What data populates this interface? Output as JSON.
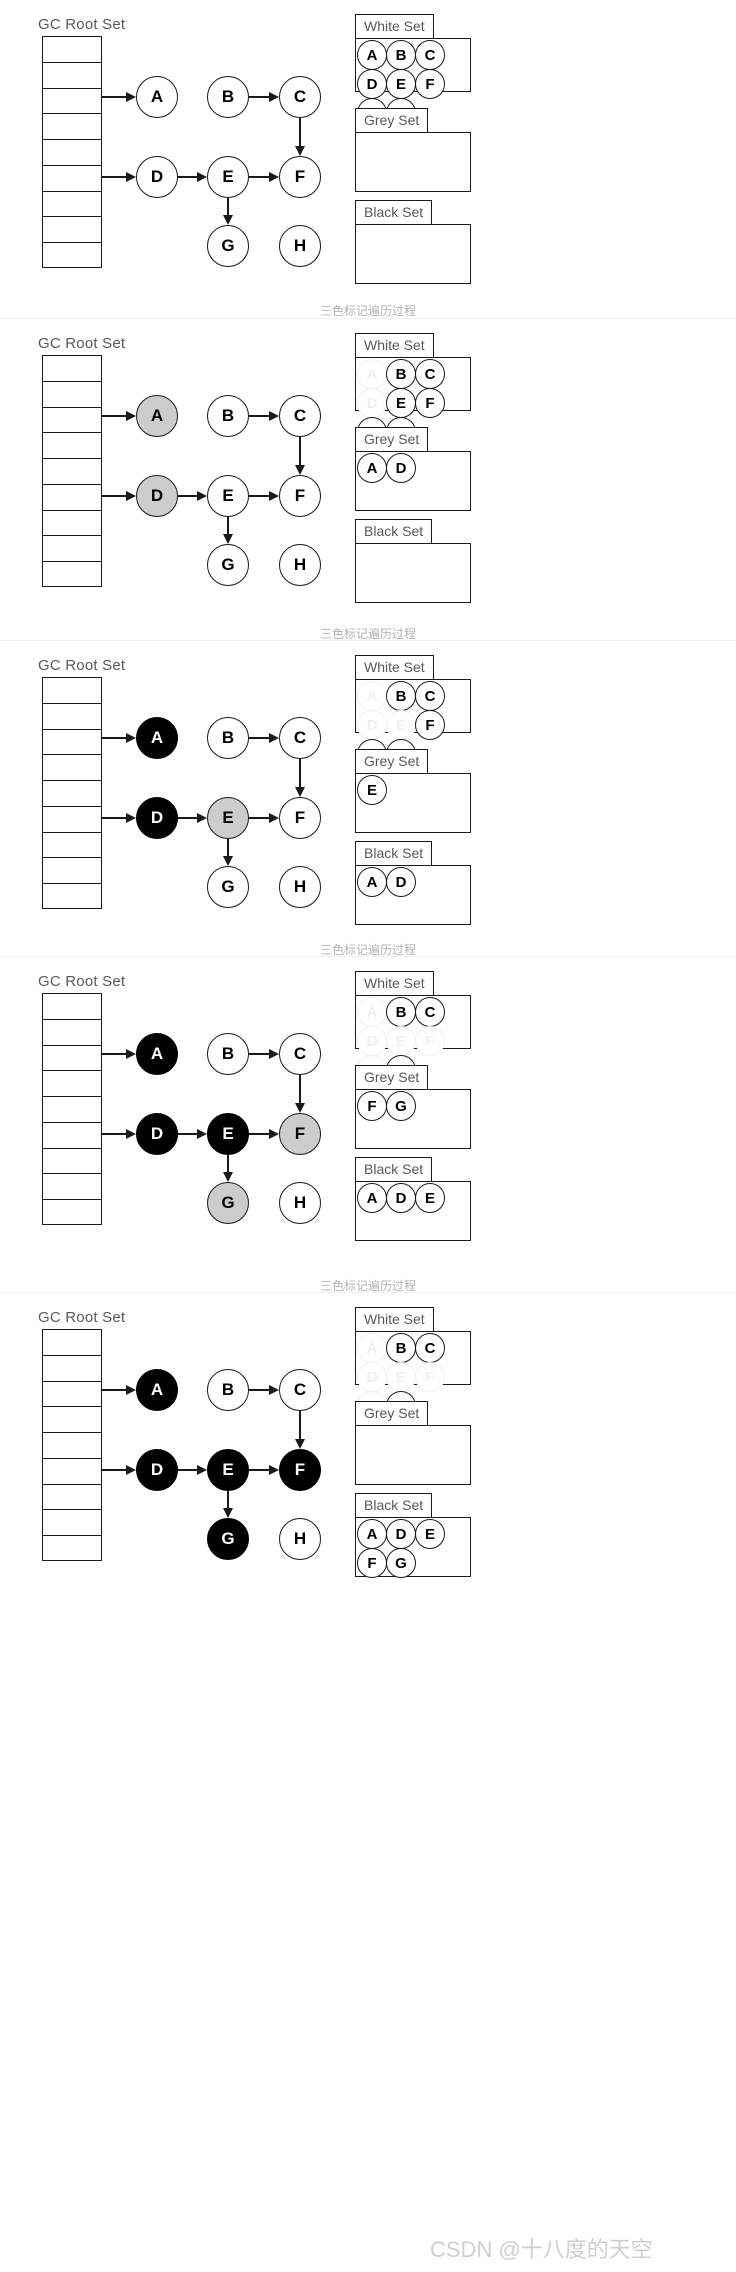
{
  "meta": {
    "caption": "三色标记遍历过程",
    "watermark": "CSDN @十八度的天空",
    "root_set_label": "GC Root Set",
    "root_set_rows": 9,
    "colors": {
      "white_node": "#ffffff",
      "grey_node": "#cccccc",
      "black_node": "#000000",
      "stroke": "#1a1a1a",
      "label_text": "#55595d",
      "caption_text": "#b3b3b3",
      "faded": "#f0f0f0"
    }
  },
  "set_titles": {
    "white": "White Set",
    "grey": "Grey Set",
    "black": "Black Set"
  },
  "graph_edges": [
    {
      "from": "root",
      "to": "A"
    },
    {
      "from": "root",
      "to": "D"
    },
    {
      "from": "B",
      "to": "C"
    },
    {
      "from": "C",
      "to": "F"
    },
    {
      "from": "D",
      "to": "E"
    },
    {
      "from": "E",
      "to": "F"
    },
    {
      "from": "E",
      "to": "G"
    }
  ],
  "node_order": [
    "A",
    "B",
    "C",
    "D",
    "E",
    "F",
    "G",
    "H"
  ],
  "sections": [
    {
      "id": "step-1",
      "label": "GC Root Set",
      "nodes": {
        "A": "white",
        "B": "white",
        "C": "white",
        "D": "white",
        "E": "white",
        "F": "white",
        "G": "white",
        "H": "white"
      },
      "white_set": [
        {
          "label": "A",
          "faded": false
        },
        {
          "label": "B",
          "faded": false
        },
        {
          "label": "C",
          "faded": false
        },
        {
          "label": "D",
          "faded": false
        },
        {
          "label": "E",
          "faded": false
        },
        {
          "label": "F",
          "faded": false
        },
        {
          "label": "G",
          "faded": false
        },
        {
          "label": "H",
          "faded": false
        }
      ],
      "grey_set": [],
      "black_set": [],
      "caption": "三色标记遍历过程"
    },
    {
      "id": "step-2",
      "label": "GC Root Set",
      "nodes": {
        "A": "grey",
        "B": "white",
        "C": "white",
        "D": "grey",
        "E": "white",
        "F": "white",
        "G": "white",
        "H": "white"
      },
      "white_set": [
        {
          "label": "A",
          "faded": true
        },
        {
          "label": "B",
          "faded": false
        },
        {
          "label": "C",
          "faded": false
        },
        {
          "label": "D",
          "faded": true
        },
        {
          "label": "E",
          "faded": false
        },
        {
          "label": "F",
          "faded": false
        },
        {
          "label": "G",
          "faded": false
        },
        {
          "label": "H",
          "faded": false
        }
      ],
      "grey_set": [
        {
          "label": "A"
        },
        {
          "label": "D"
        }
      ],
      "black_set": [],
      "caption": "三色标记遍历过程"
    },
    {
      "id": "step-3",
      "label": "GC Root Set",
      "nodes": {
        "A": "black",
        "B": "white",
        "C": "white",
        "D": "black",
        "E": "grey",
        "F": "white",
        "G": "white",
        "H": "white"
      },
      "white_set": [
        {
          "label": "A",
          "faded": true
        },
        {
          "label": "B",
          "faded": false
        },
        {
          "label": "C",
          "faded": false
        },
        {
          "label": "D",
          "faded": true
        },
        {
          "label": "E",
          "faded": true
        },
        {
          "label": "F",
          "faded": false
        },
        {
          "label": "G",
          "faded": false
        },
        {
          "label": "H",
          "faded": false
        }
      ],
      "grey_set": [
        {
          "label": "E"
        }
      ],
      "black_set": [
        {
          "label": "A"
        },
        {
          "label": "D"
        }
      ],
      "caption": "三色标记遍历过程"
    },
    {
      "id": "step-4",
      "label": "GC Root Set",
      "nodes": {
        "A": "black",
        "B": "white",
        "C": "white",
        "D": "black",
        "E": "black",
        "F": "grey",
        "G": "grey",
        "H": "white"
      },
      "white_set": [
        {
          "label": "A",
          "faded": true
        },
        {
          "label": "B",
          "faded": false
        },
        {
          "label": "C",
          "faded": false
        },
        {
          "label": "D",
          "faded": true
        },
        {
          "label": "E",
          "faded": true
        },
        {
          "label": "F",
          "faded": true
        },
        {
          "label": "G",
          "faded": true
        },
        {
          "label": "H",
          "faded": false
        }
      ],
      "grey_set": [
        {
          "label": "F"
        },
        {
          "label": "G"
        }
      ],
      "black_set": [
        {
          "label": "A"
        },
        {
          "label": "D"
        },
        {
          "label": "E"
        }
      ],
      "caption": "三色标记遍历过程"
    },
    {
      "id": "step-5",
      "label": "GC Root Set",
      "nodes": {
        "A": "black",
        "B": "white",
        "C": "white",
        "D": "black",
        "E": "black",
        "F": "black",
        "G": "black",
        "H": "white"
      },
      "white_set": [
        {
          "label": "A",
          "faded": true
        },
        {
          "label": "B",
          "faded": false
        },
        {
          "label": "C",
          "faded": false
        },
        {
          "label": "D",
          "faded": true
        },
        {
          "label": "E",
          "faded": true
        },
        {
          "label": "F",
          "faded": true
        },
        {
          "label": "G",
          "faded": true
        },
        {
          "label": "H",
          "faded": false
        }
      ],
      "grey_set": [],
      "black_set": [
        {
          "label": "A"
        },
        {
          "label": "D"
        },
        {
          "label": "E"
        },
        {
          "label": "F"
        },
        {
          "label": "G"
        }
      ],
      "caption": ""
    }
  ]
}
